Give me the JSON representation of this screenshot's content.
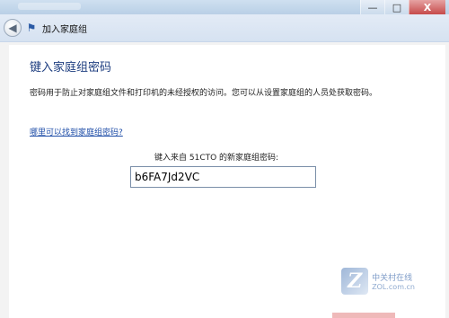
{
  "window": {
    "minimize": "—",
    "maximize": "□",
    "close": "X"
  },
  "nav": {
    "title": "加入家庭组"
  },
  "content": {
    "heading": "键入家庭组密码",
    "description": "密码用于防止对家庭组文件和打印机的未经授权的访问。您可以从设置家庭组的人员处获取密码。",
    "help_link": "哪里可以找到家庭组密码?",
    "prompt": "键入来自 51CTO 的新家庭组密码:",
    "password_value": "b6FA7Jd2VC"
  },
  "watermark": {
    "logo_letter": "Z",
    "line1": "中关村在线",
    "line2": "ZOL.com.cn"
  },
  "colors": {
    "heading": "#1e3e80",
    "link": "#1f4ea8"
  }
}
